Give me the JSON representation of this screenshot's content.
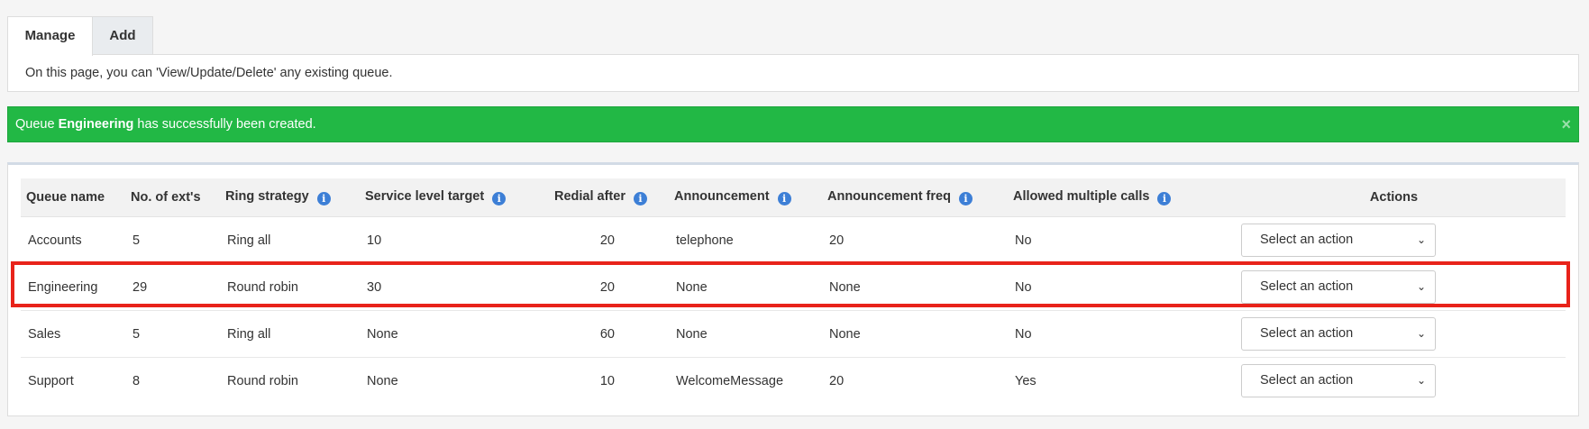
{
  "tabs": [
    {
      "label": "Manage",
      "active": true
    },
    {
      "label": "Add",
      "active": false
    }
  ],
  "info_text": "On this page, you can 'View/Update/Delete' any existing queue.",
  "alert": {
    "prefix": "Queue ",
    "name": "Engineering",
    "suffix": " has successfully been created.",
    "close": "×",
    "color": "#22b845"
  },
  "table": {
    "headers": {
      "queue_name": "Queue name",
      "num_exts": "No. of ext's",
      "ring_strategy": "Ring strategy",
      "service_level": "Service level target",
      "redial_after": "Redial after",
      "announcement": "Announcement",
      "announcement_freq": "Announcement freq",
      "allowed_multiple": "Allowed multiple calls",
      "actions": "Actions"
    },
    "info_icon": "i",
    "rows": [
      {
        "name": "Accounts",
        "exts": "5",
        "strategy": "Ring all",
        "service": "10",
        "redial": "20",
        "announcement": "telephone",
        "freq": "20",
        "multiple": "No",
        "action": "Select an action"
      },
      {
        "name": "Engineering",
        "exts": "29",
        "strategy": "Round robin",
        "service": "30",
        "redial": "20",
        "announcement": "None",
        "freq": "None",
        "multiple": "No",
        "action": "Select an action"
      },
      {
        "name": "Sales",
        "exts": "5",
        "strategy": "Ring all",
        "service": "None",
        "redial": "60",
        "announcement": "None",
        "freq": "None",
        "multiple": "No",
        "action": "Select an action"
      },
      {
        "name": "Support",
        "exts": "8",
        "strategy": "Round robin",
        "service": "None",
        "redial": "10",
        "announcement": "WelcomeMessage",
        "freq": "20",
        "multiple": "Yes",
        "action": "Select an action"
      }
    ]
  },
  "highlight_color": "#e8231a",
  "chevron": "⌄"
}
